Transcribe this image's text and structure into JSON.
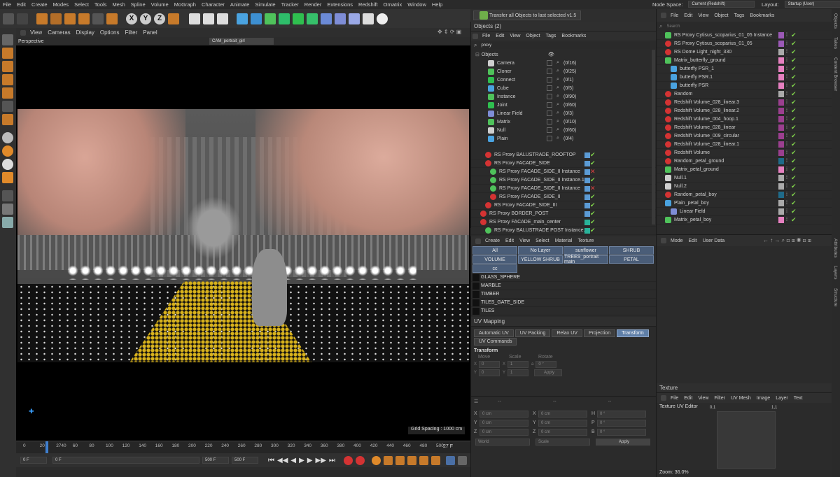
{
  "app": {
    "menu": [
      "File",
      "Edit",
      "Create",
      "Modes",
      "Select",
      "Tools",
      "Mesh",
      "Spline",
      "Volume",
      "MoGraph",
      "Character",
      "Animate",
      "Simulate",
      "Tracker",
      "Render",
      "Extensions",
      "Redshift",
      "Ornatrix",
      "Window",
      "Help"
    ],
    "node_space_label": "Node Space:",
    "node_space_value": "Current (Redshift)",
    "layout_label": "Layout:",
    "layout_value": "Startup (User)"
  },
  "toolbar": {
    "axis_x": "X",
    "axis_y": "Y",
    "axis_z": "Z",
    "script_button": "Transfer all Objects to last selected v1.5"
  },
  "viewport": {
    "menu": [
      "View",
      "Cameras",
      "Display",
      "Options",
      "Filter",
      "Panel"
    ],
    "mode": "Perspective",
    "camera": "CAM_portrait_girl",
    "grid_spacing": "Grid Spacing : 1000 cm"
  },
  "timeline": {
    "ticks": [
      "0",
      "20",
      "2740",
      "60",
      "80",
      "100",
      "120",
      "140",
      "160",
      "180",
      "200",
      "220",
      "240",
      "260",
      "280",
      "300",
      "320",
      "340",
      "360",
      "380",
      "400",
      "420",
      "440",
      "460",
      "480",
      "500"
    ],
    "current_frame": "27 F",
    "field_start": "0 F",
    "field_current": "0 F",
    "field_end": "500 F",
    "field_max": "500 F"
  },
  "objects_panel": {
    "title": "Objects (2)",
    "menu": [
      "File",
      "Edit",
      "View",
      "Object",
      "Tags",
      "Bookmarks"
    ],
    "filter_text": "proxy",
    "filter_root": "Objects",
    "filters": [
      {
        "name": "Camera",
        "count": "(0/16)"
      },
      {
        "name": "Cloner",
        "count": "(0/25)"
      },
      {
        "name": "Connect",
        "count": "(0/1)"
      },
      {
        "name": "Cube",
        "count": "(0/5)"
      },
      {
        "name": "Instance",
        "count": "(0/90)"
      },
      {
        "name": "Joint",
        "count": "(0/60)"
      },
      {
        "name": "Linear Field",
        "count": "(0/3)"
      },
      {
        "name": "Matrix",
        "count": "(0/10)"
      },
      {
        "name": "Null",
        "count": "(0/60)"
      },
      {
        "name": "Plain",
        "count": "(0/4)"
      }
    ],
    "items": [
      {
        "name": "RS Proxy BALUSTRADE_ROOFTOP",
        "indent": 2,
        "type": "rs",
        "color": "#5b9bd5",
        "state": "check"
      },
      {
        "name": "RS Proxy FACADE_SIDE",
        "indent": 2,
        "type": "rs",
        "color": "#5b9bd5",
        "state": "check"
      },
      {
        "name": "RS Proxy FACADE_SIDE_II Instance",
        "indent": 3,
        "type": "inst",
        "color": "#5b9bd5",
        "state": "cross"
      },
      {
        "name": "RS Proxy FACADE_SIDE_II Instance.1",
        "indent": 3,
        "type": "inst",
        "color": "#5b9bd5",
        "state": "check"
      },
      {
        "name": "RS Proxy FACADE_SIDE_II Instance",
        "indent": 3,
        "type": "inst",
        "color": "#5b9bd5",
        "state": "cross"
      },
      {
        "name": "RS Proxy FACADE_SIDE_II",
        "indent": 3,
        "type": "rs",
        "color": "#5b9bd5",
        "state": "check"
      },
      {
        "name": "RS Proxy FACADE_SIDE_III",
        "indent": 2,
        "type": "rs",
        "color": "#5b9bd5",
        "state": "check"
      },
      {
        "name": "RS Proxy BORDER_POST",
        "indent": 1,
        "type": "rs",
        "color": "#5b9bd5",
        "state": "check"
      },
      {
        "name": "RS Proxy FACADE_main_center",
        "indent": 1,
        "type": "rs",
        "color": "#29b39a",
        "state": "check"
      },
      {
        "name": "RS Proxy BALUSTRADE POST Instance.2",
        "indent": 2,
        "type": "inst",
        "color": "#29b39a",
        "state": "check"
      }
    ]
  },
  "materials_panel": {
    "menu": [
      "Create",
      "Edit",
      "View",
      "Select",
      "Material",
      "Texture"
    ],
    "layer_buttons": [
      "All",
      "No Layer",
      "sunflower",
      "SHRUB",
      "VOLUME",
      "YELLOW SHRUB",
      "TREES_portrait main",
      "PETAL",
      "cc"
    ],
    "materials": [
      "GLASS_SPHERE",
      "MARBLE",
      "TIMBER",
      "TILES_GATE_SIDE",
      "TILES"
    ]
  },
  "uv_panel": {
    "title": "UV Mapping",
    "tabs": [
      "Automatic UV",
      "UV Packing",
      "Relax UV",
      "Projection",
      "Transform",
      "UV Commands"
    ],
    "active_tab": "Transform",
    "section": "Transform",
    "col_move": "Move",
    "col_scale": "Scale",
    "col_rotate": "Rotate",
    "move_x": "0",
    "move_y": "0",
    "scale_x": "1",
    "scale_y": "1",
    "rotate": "0 °",
    "apply": "Apply"
  },
  "coords_panel": {
    "col1": "--",
    "col2": "--",
    "col3": "--",
    "rows": [
      {
        "a": "X",
        "av": "0 cm",
        "b": "X",
        "bv": "0 cm",
        "c": "H",
        "cv": "0 °"
      },
      {
        "a": "Y",
        "av": "0 cm",
        "b": "Y",
        "bv": "0 cm",
        "c": "P",
        "cv": "0 °"
      },
      {
        "a": "Z",
        "av": "0 cm",
        "b": "Z",
        "bv": "0 cm",
        "c": "B",
        "cv": "0 °"
      }
    ],
    "mode": "World",
    "scale": "Scale",
    "apply": "Apply"
  },
  "right_objects": {
    "menu": [
      "File",
      "Edit",
      "View",
      "Object",
      "Tags",
      "Bookmarks"
    ],
    "search_placeholder": "Search",
    "items": [
      {
        "name": "RS Proxy Cytisus_scoparius_01_05 Instance",
        "indent": 1,
        "type": "inst",
        "color": "#9b59b6"
      },
      {
        "name": "RS Proxy Cytisus_scoparius_01_05",
        "indent": 1,
        "type": "rs",
        "color": "#9b59b6"
      },
      {
        "name": "RS Dome Light_night_330",
        "indent": 1,
        "type": "rs",
        "color": "#aaaaaa"
      },
      {
        "name": "Matrix_butterfly_ground",
        "indent": 1,
        "type": "matrix",
        "color": "#e680c0"
      },
      {
        "name": "butterfly PSR_1",
        "indent": 2,
        "type": "psr",
        "color": "#e680c0"
      },
      {
        "name": "butterfly PSR.1",
        "indent": 2,
        "type": "psr",
        "color": "#e680c0"
      },
      {
        "name": "butterfly PSR",
        "indent": 2,
        "type": "psr",
        "color": "#e680c0"
      },
      {
        "name": "Random",
        "indent": 1,
        "type": "rs",
        "color": "#aaaaaa"
      },
      {
        "name": "Redshift Volume_028_linear.3",
        "indent": 1,
        "type": "rs",
        "color": "#9b3f8f"
      },
      {
        "name": "Redshift Volume_028_linear.2",
        "indent": 1,
        "type": "rs",
        "color": "#9b3f8f"
      },
      {
        "name": "Redshift Volume_004_hoop.1",
        "indent": 1,
        "type": "rs",
        "color": "#9b3f8f"
      },
      {
        "name": "Redshift Volume_028_linear",
        "indent": 1,
        "type": "rs",
        "color": "#9b3f8f"
      },
      {
        "name": "Redshift Volume_009_circular",
        "indent": 1,
        "type": "rs",
        "color": "#9b3f8f"
      },
      {
        "name": "Redshift Volume_028_linear.1",
        "indent": 1,
        "type": "rs",
        "color": "#9b3f8f"
      },
      {
        "name": "Redshift Volume",
        "indent": 1,
        "type": "rs",
        "color": "#9b3f8f"
      },
      {
        "name": "Random_petal_ground",
        "indent": 1,
        "type": "rs",
        "color": "#1f6b8a"
      },
      {
        "name": "Matrix_petal_ground",
        "indent": 1,
        "type": "matrix",
        "color": "#e680c0"
      },
      {
        "name": "Null.1",
        "indent": 1,
        "type": "null",
        "color": "#aaaaaa"
      },
      {
        "name": "Null.2",
        "indent": 1,
        "type": "null",
        "color": "#aaaaaa"
      },
      {
        "name": "Random_petal_boy",
        "indent": 1,
        "type": "rs",
        "color": "#1f6b8a"
      },
      {
        "name": "Plain_petal_boy",
        "indent": 1,
        "type": "plain",
        "color": "#aaaaaa"
      },
      {
        "name": "Linear Field",
        "indent": 2,
        "type": "field",
        "color": "#aaaaaa"
      },
      {
        "name": "Matrix_petal_boy",
        "indent": 1,
        "type": "matrix",
        "color": "#e680c0"
      }
    ],
    "side_tabs": [
      "Objects",
      "Takes",
      "Content Browser"
    ]
  },
  "attributes": {
    "menu": [
      "Mode",
      "Edit",
      "User Data"
    ],
    "side_tabs": [
      "Attributes",
      "Layers",
      "Structure"
    ]
  },
  "texture_panel": {
    "title": "Texture",
    "menu": [
      "File",
      "Edit",
      "View",
      "Filter",
      "UV Mesh",
      "Image",
      "Layer",
      "Text"
    ],
    "editor_label": "Texture UV Editor",
    "corner_tl": "0,1",
    "corner_tr": "1,1",
    "zoom": "Zoom: 36.0%"
  },
  "colors": {
    "accent": "#5f7fa8",
    "layer_button": "#4a5d78",
    "rs_red": "#d43333",
    "check_green": "#7fd14a"
  }
}
